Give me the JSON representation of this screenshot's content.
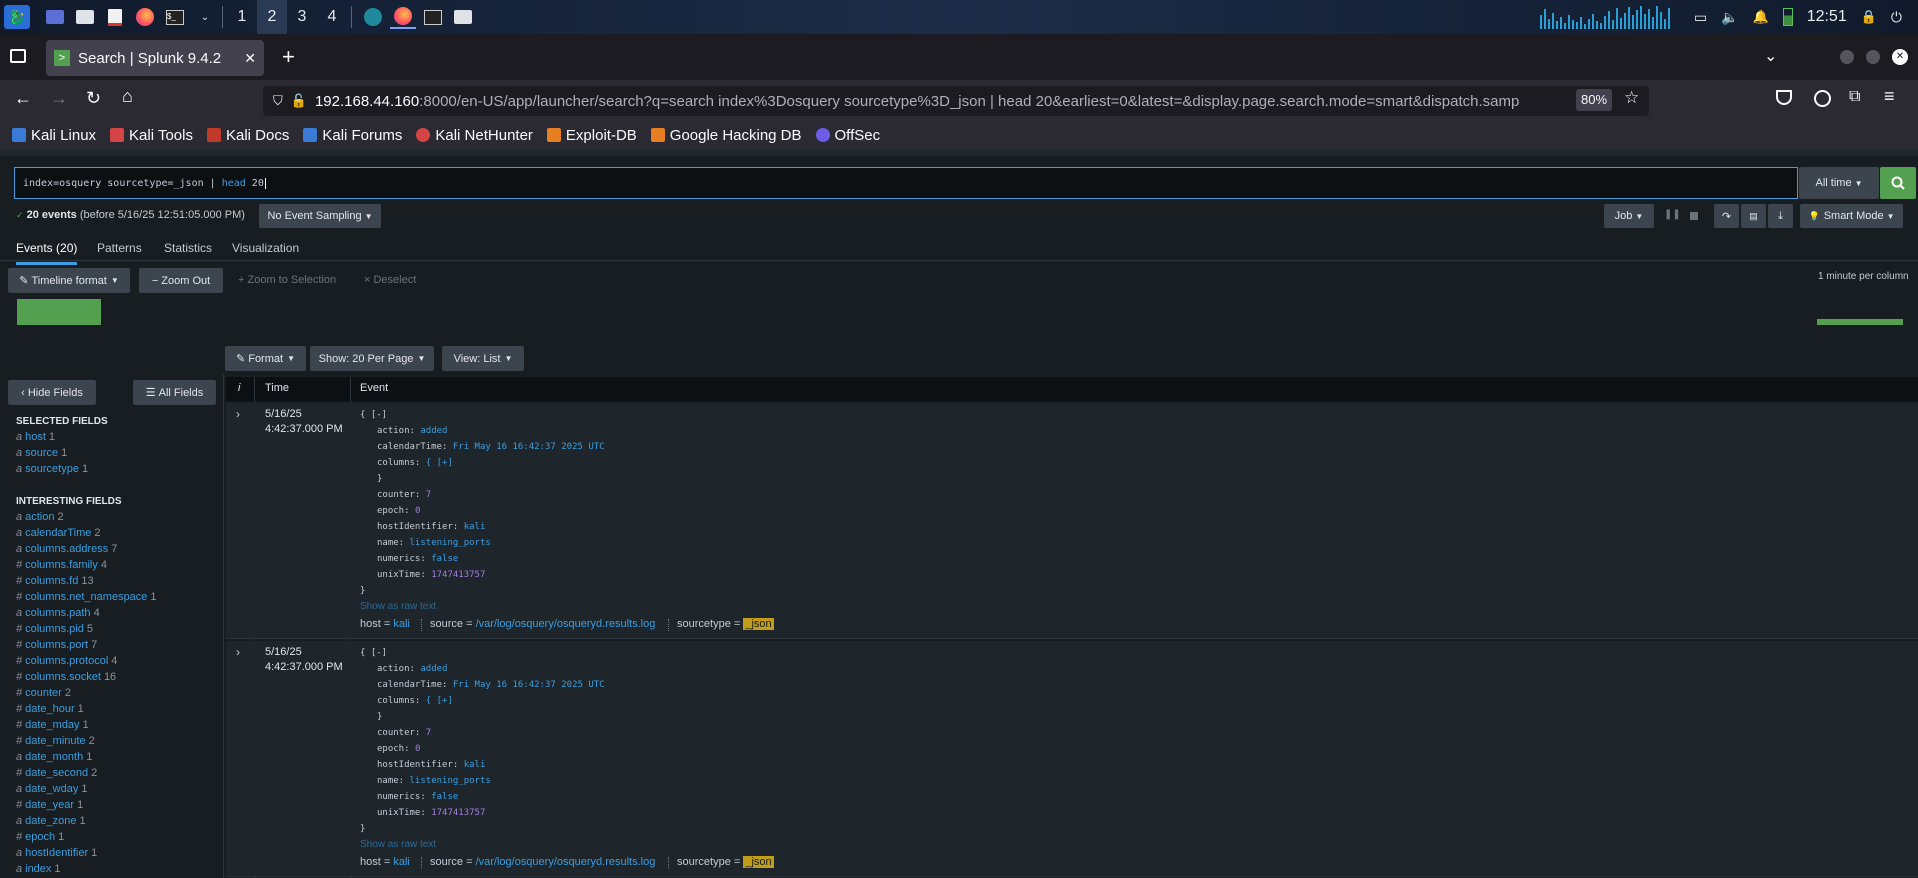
{
  "taskbar": {
    "workspaces": [
      "1",
      "2",
      "3",
      "4"
    ],
    "active_workspace": "2",
    "clock": "12:51"
  },
  "browser": {
    "tab_title": "Search | Splunk 9.4.2",
    "url_host": "192.168.44.160",
    "url_rest": ":8000/en-US/app/launcher/search?q=search index%3Dosquery sourcetype%3D_json | head 20&earliest=0&latest=&display.page.search.mode=smart&dispatch.samp",
    "zoom": "80%",
    "bookmarks": [
      "Kali Linux",
      "Kali Tools",
      "Kali Docs",
      "Kali Forums",
      "Kali NetHunter",
      "Exploit-DB",
      "Google Hacking DB",
      "OffSec"
    ]
  },
  "search": {
    "query_prefix": "index=osquery sourcetype=_json | ",
    "query_cmd": "head",
    "query_arg": " 20",
    "time_range": "All time",
    "result_count": "20 events",
    "result_detail": "(before 5/16/25 12:51:05.000 PM)",
    "sampling": "No Event Sampling",
    "job": "Job",
    "mode": "Smart Mode"
  },
  "tabs": [
    "Events (20)",
    "Patterns",
    "Statistics",
    "Visualization"
  ],
  "timeline": {
    "format": "Timeline format",
    "zoom_out": "Zoom Out",
    "zoom_selection": "Zoom to Selection",
    "deselect": "Deselect",
    "scale": "1 minute per column"
  },
  "list_controls": {
    "format": "Format",
    "per_page": "Show: 20 Per Page",
    "view": "View: List"
  },
  "sidebar": {
    "hide_fields": "Hide Fields",
    "all_fields": "All Fields",
    "selected_title": "SELECTED FIELDS",
    "selected": [
      {
        "type": "a",
        "name": "host",
        "count": "1"
      },
      {
        "type": "a",
        "name": "source",
        "count": "1"
      },
      {
        "type": "a",
        "name": "sourcetype",
        "count": "1"
      }
    ],
    "interesting_title": "INTERESTING FIELDS",
    "interesting": [
      {
        "type": "a",
        "name": "action",
        "count": "2"
      },
      {
        "type": "a",
        "name": "calendarTime",
        "count": "2"
      },
      {
        "type": "a",
        "name": "columns.address",
        "count": "7"
      },
      {
        "type": "#",
        "name": "columns.family",
        "count": "4"
      },
      {
        "type": "#",
        "name": "columns.fd",
        "count": "13"
      },
      {
        "type": "#",
        "name": "columns.net_namespace",
        "count": "1"
      },
      {
        "type": "a",
        "name": "columns.path",
        "count": "4"
      },
      {
        "type": "#",
        "name": "columns.pid",
        "count": "5"
      },
      {
        "type": "#",
        "name": "columns.port",
        "count": "7"
      },
      {
        "type": "#",
        "name": "columns.protocol",
        "count": "4"
      },
      {
        "type": "#",
        "name": "columns.socket",
        "count": "16"
      },
      {
        "type": "#",
        "name": "counter",
        "count": "2"
      },
      {
        "type": "#",
        "name": "date_hour",
        "count": "1"
      },
      {
        "type": "#",
        "name": "date_mday",
        "count": "1"
      },
      {
        "type": "#",
        "name": "date_minute",
        "count": "2"
      },
      {
        "type": "a",
        "name": "date_month",
        "count": "1"
      },
      {
        "type": "#",
        "name": "date_second",
        "count": "2"
      },
      {
        "type": "a",
        "name": "date_wday",
        "count": "1"
      },
      {
        "type": "#",
        "name": "date_year",
        "count": "1"
      },
      {
        "type": "a",
        "name": "date_zone",
        "count": "1"
      },
      {
        "type": "#",
        "name": "epoch",
        "count": "1"
      },
      {
        "type": "a",
        "name": "hostIdentifier",
        "count": "1"
      },
      {
        "type": "a",
        "name": "index",
        "count": "1"
      }
    ]
  },
  "table": {
    "col_info": "i",
    "col_time": "Time",
    "col_event": "Event"
  },
  "events": [
    {
      "date": "5/16/25",
      "time": "4:42:37.000 PM",
      "open": "{ [-]",
      "action_k": "action: ",
      "action_v": "added",
      "cal_k": "calendarTime: ",
      "cal_v": "Fri May 16 16:42:37 2025 UTC",
      "cols_k": "columns: ",
      "cols_v": "{ [+]",
      "cols_close": "}",
      "counter_k": "counter: ",
      "counter_v": "7",
      "epoch_k": "epoch: ",
      "epoch_v": "0",
      "hid_k": "hostIdentifier: ",
      "hid_v": "kali",
      "name_k": "name: ",
      "name_v": "listening_ports",
      "num_k": "numerics: ",
      "num_v": "false",
      "unix_k": "unixTime: ",
      "unix_v": "1747413757",
      "close": "}",
      "raw": "Show as raw text",
      "host": "kali",
      "source": "/var/log/osquery/osqueryd.results.log",
      "sourcetype": "_json"
    },
    {
      "date": "5/16/25",
      "time": "4:42:37.000 PM",
      "open": "{ [-]",
      "action_k": "action: ",
      "action_v": "added",
      "cal_k": "calendarTime: ",
      "cal_v": "Fri May 16 16:42:37 2025 UTC",
      "cols_k": "columns: ",
      "cols_v": "{ [+]",
      "cols_close": "}",
      "counter_k": "counter: ",
      "counter_v": "7",
      "epoch_k": "epoch: ",
      "epoch_v": "0",
      "hid_k": "hostIdentifier: ",
      "hid_v": "kali",
      "name_k": "name: ",
      "name_v": "listening_ports",
      "num_k": "numerics: ",
      "num_v": "false",
      "unix_k": "unixTime: ",
      "unix_v": "1747413757",
      "close": "}",
      "raw": "Show as raw text",
      "host": "kali",
      "source": "/var/log/osquery/osqueryd.results.log",
      "sourcetype": "_json"
    }
  ],
  "meta_labels": {
    "host": "host = ",
    "source": "source = ",
    "sourcetype": "sourcetype = "
  },
  "colors": {
    "accent": "#3c9ee0",
    "success": "#53a051",
    "highlight": "#c19d1a"
  }
}
